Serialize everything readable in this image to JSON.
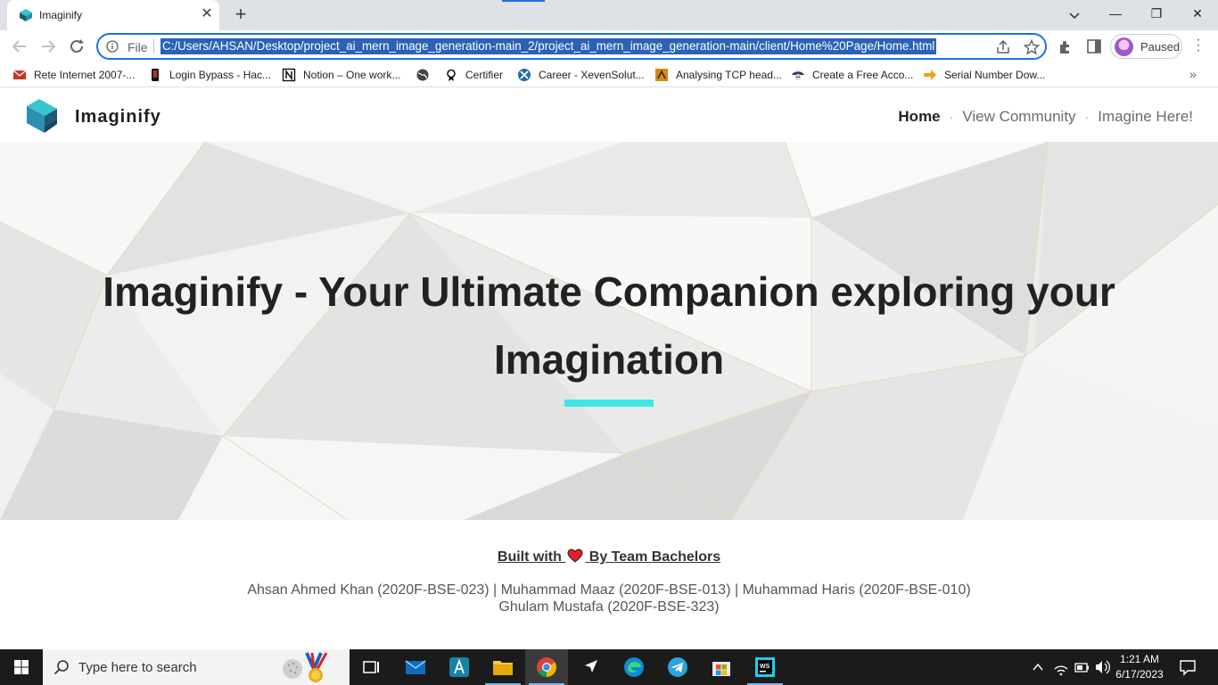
{
  "browser": {
    "tab": {
      "title": "Imaginify",
      "close": "✕"
    },
    "new_tab": "+",
    "window_controls": {
      "minimize": "—",
      "restore": "❐",
      "close": "✕"
    },
    "omnibox": {
      "scheme_label": "File",
      "url": "C:/Users/AHSAN/Desktop/project_ai_mern_image_generation-main_2/project_ai_mern_image_generation-main/client/Home%20Page/Home.html"
    },
    "profile": {
      "label": "Paused"
    },
    "menu": "⋮",
    "bookmarks": [
      {
        "label": "Rete Internet 2007-...",
        "icon": "red-envelope-icon"
      },
      {
        "label": "Login Bypass - Hac...",
        "icon": "phone-icon"
      },
      {
        "label": "Notion – One work...",
        "icon": "notion-icon"
      },
      {
        "label": "",
        "icon": "globe-icon"
      },
      {
        "label": "Certifier",
        "icon": "certifier-icon"
      },
      {
        "label": "Career - XevenSolut...",
        "icon": "xeven-icon"
      },
      {
        "label": "Analysing TCP head...",
        "icon": "tcp-icon"
      },
      {
        "label": "Create a Free Acco...",
        "icon": "pirate-icon"
      },
      {
        "label": "Serial Number Dow...",
        "icon": "arrow-icon"
      }
    ],
    "bookmarks_more": "»"
  },
  "site": {
    "brand": "Imaginify",
    "nav": {
      "home": "Home",
      "community": "View Community",
      "imagine": "Imagine Here!",
      "separator": "·"
    },
    "hero": {
      "title": "Imaginify - Your Ultimate Companion exploring your Imagination"
    },
    "footer": {
      "built_prefix": "Built with",
      "built_suffix": "By Team Bachelors",
      "team_line1": "Ahsan Ahmed Khan (2020F-BSE-023) | Muhammad Maaz (2020F-BSE-013) | Muhammad Haris (2020F-BSE-010)",
      "team_line2": "Ghulam Mustafa (2020F-BSE-323)"
    },
    "colors": {
      "accent": "#3ee6e6",
      "logo_teal": "#35c6cf",
      "logo_dark": "#1e5a72"
    }
  },
  "taskbar": {
    "search_placeholder": "Type here to search",
    "apps": [
      "task-view",
      "mail",
      "app-a",
      "file-explorer",
      "chrome",
      "app-arrow",
      "edge",
      "telegram",
      "store",
      "webstorm"
    ],
    "active_app": "chrome",
    "clock": {
      "time": "1:21 AM",
      "date": "6/17/2023"
    }
  }
}
